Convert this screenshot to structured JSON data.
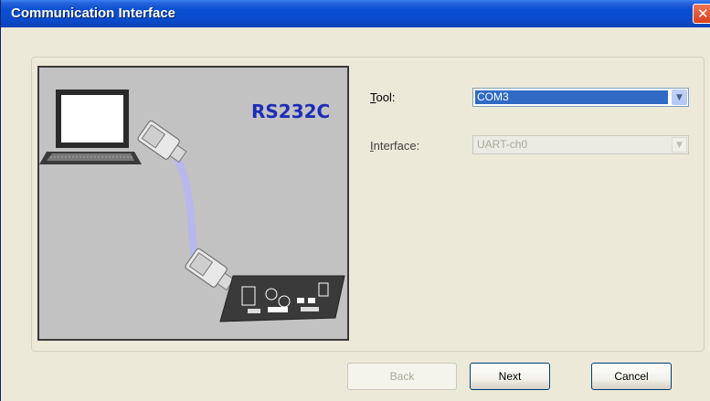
{
  "window": {
    "title": "Communication Interface",
    "close_icon": "close-icon"
  },
  "illustration": {
    "label": "RS232C",
    "icons": [
      "laptop-icon",
      "serial-connector-icon",
      "serial-cable-icon",
      "circuit-board-icon"
    ]
  },
  "form": {
    "tool": {
      "label": "Tool:",
      "accesskey": "T",
      "value": "COM3"
    },
    "interface": {
      "label": "Interface:",
      "accesskey": "I",
      "value": "UART-ch0",
      "disabled": true
    }
  },
  "buttons": {
    "back": {
      "label": "Back",
      "disabled": true
    },
    "next": {
      "label": "Next"
    },
    "cancel": {
      "label": "Cancel"
    }
  },
  "colors": {
    "titlebar": "#0a4fd2",
    "selection": "#316ac5",
    "rs232c_text": "#1e2cb8",
    "close_button": "#d8401c"
  }
}
